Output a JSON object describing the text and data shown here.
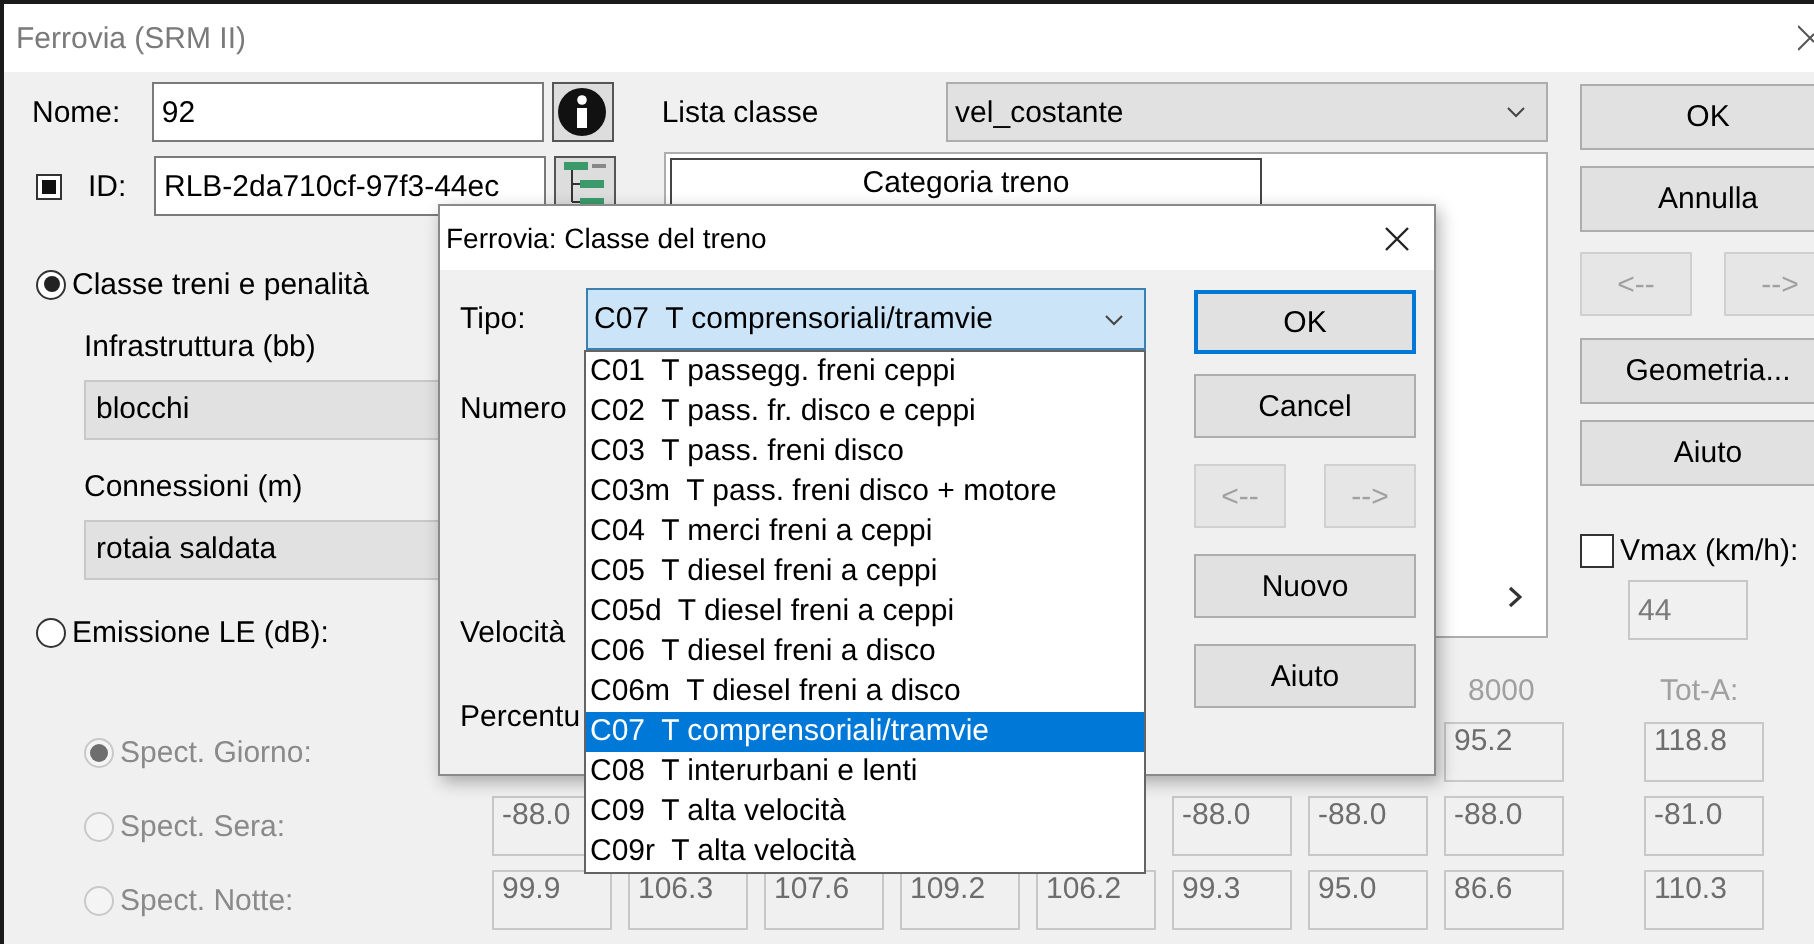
{
  "window": {
    "title": "Ferrovia (SRM II)"
  },
  "nome": {
    "label": "Nome:",
    "value": "92"
  },
  "id": {
    "label": "ID:",
    "value": "RLB-2da710cf-97f3-44ec",
    "checked": true
  },
  "lista_classe": {
    "label": "Lista classe",
    "value": "vel_costante"
  },
  "class_list": {
    "header": "Categoria treno"
  },
  "mode_options": [
    {
      "label": "Classe treni e penalità",
      "selected": true
    },
    {
      "label": "Emissione LE (dB):",
      "selected": false
    }
  ],
  "infrastruttura": {
    "label": "Infrastruttura (bb)",
    "value": "blocchi"
  },
  "connessioni": {
    "label": "Connessioni (m)",
    "value": "rotaia saldata"
  },
  "buttons": [
    {
      "label": "OK"
    },
    {
      "label": "Annulla"
    }
  ],
  "nav_buttons": [
    {
      "label": "<--",
      "disabled": true
    },
    {
      "label": "-->",
      "disabled": true
    }
  ],
  "buttons2": [
    {
      "label": "Geometria..."
    },
    {
      "label": "Aiuto"
    }
  ],
  "vmax": {
    "label": "Vmax (km/h):",
    "checked": false,
    "value": "44",
    "disabled": true
  },
  "spectra": {
    "disabled": true,
    "right_headers": [
      "8000"
    ],
    "total_header": "Tot-A:",
    "rows": [
      {
        "label": "Spect. Giorno:",
        "selected": true,
        "right_cells": [
          "95.2"
        ],
        "total": "118.8"
      },
      {
        "label": "Spect. Sera:",
        "selected": false,
        "left_cells": [
          "-88.0"
        ],
        "right_cells": [
          "-88.0",
          "-88.0",
          "-88.0"
        ],
        "total": "-81.0"
      },
      {
        "label": "Spect. Notte:",
        "selected": false,
        "left_cells": [
          "99.9",
          "106.3",
          "107.6",
          "109.2",
          "106.2",
          "99.3",
          "95.0",
          "86.6"
        ],
        "total": "110.3"
      }
    ]
  },
  "dialog": {
    "title": "Ferrovia: Classe del treno",
    "tipo": {
      "label": "Tipo:",
      "value": "C07  T comprensoriali/tramvie",
      "open": true
    },
    "labels": [
      "Numero",
      "Velocità",
      "Percentu"
    ],
    "buttons": [
      {
        "label": "OK",
        "default": true
      },
      {
        "label": "Cancel",
        "default": false
      }
    ],
    "nav_buttons": [
      {
        "label": "<--",
        "disabled": true
      },
      {
        "label": "-->",
        "disabled": true
      }
    ],
    "buttons2": [
      {
        "label": "Nuovo"
      },
      {
        "label": "Aiuto"
      }
    ],
    "options": [
      {
        "label": "C01  T passegg. freni ceppi",
        "selected": false
      },
      {
        "label": "C02  T pass. fr. disco e ceppi",
        "selected": false
      },
      {
        "label": "C03  T pass. freni disco",
        "selected": false
      },
      {
        "label": "C03m  T pass. freni disco + motore",
        "selected": false
      },
      {
        "label": "C04  T merci freni a ceppi",
        "selected": false
      },
      {
        "label": "C05  T diesel freni a ceppi",
        "selected": false
      },
      {
        "label": "C05d  T diesel freni a ceppi",
        "selected": false
      },
      {
        "label": "C06  T diesel freni a disco",
        "selected": false
      },
      {
        "label": "C06m  T diesel freni a disco",
        "selected": false
      },
      {
        "label": "C07  T comprensoriali/tramvie",
        "selected": true
      },
      {
        "label": "C08  T interurbani e lenti",
        "selected": false
      },
      {
        "label": "C09  T alta velocità",
        "selected": false
      },
      {
        "label": "C09r  T alta velocità",
        "selected": false
      }
    ]
  }
}
